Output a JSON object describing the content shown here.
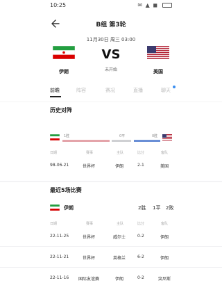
{
  "statusbar": {
    "time": "10:25",
    "icons": "✉ ▲ ◼"
  },
  "header": {
    "title": "B组 第3轮",
    "datetime": "11月30日 周三 03:00",
    "home_team": "伊朗",
    "away_team": "美国",
    "vs": "VS",
    "status": "未开始"
  },
  "tabs": [
    "前瞻",
    "阵容",
    "赛况",
    "直播",
    "聊天"
  ],
  "h2h": {
    "title": "历史对阵",
    "home_wins": "1胜",
    "draws": "0平",
    "away_wins": "0胜",
    "columns": [
      "日期",
      "赛事",
      "主队",
      "比分",
      "客队"
    ],
    "rows": [
      [
        "98-06-21",
        "世界杯",
        "伊朗",
        "2-1",
        "美国"
      ]
    ]
  },
  "recent": {
    "title": "最近5场比赛",
    "team": "伊朗",
    "wins": "2胜",
    "draws": "1平",
    "losses": "2败",
    "columns": [
      "日期",
      "赛事",
      "主队",
      "比分",
      "客队"
    ],
    "rows": [
      [
        "22-11-25",
        "世界杯",
        "威尔士",
        "0-2",
        "伊朗"
      ],
      [
        "22-11-21",
        "世界杯",
        "英格兰",
        "6-2",
        "伊朗"
      ],
      [
        "22-11-16",
        "国际友谊赛",
        "伊朗",
        "0-2",
        "突尼斯"
      ]
    ]
  },
  "colors": {
    "iran_green": "#239f40",
    "iran_red": "#da0000",
    "usa_red": "#b22234",
    "usa_blue": "#3c3b6e",
    "accent": "#3a8ef0"
  }
}
